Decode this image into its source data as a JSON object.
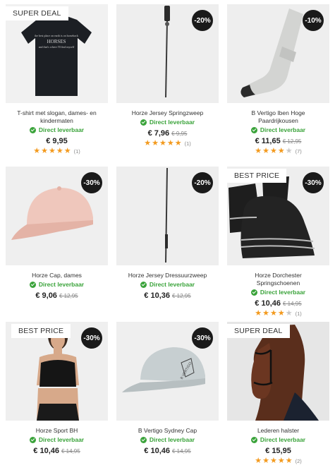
{
  "products": [
    {
      "name": "T-shirt met slogan, dames- en kindermaten",
      "badge": "SUPER DEAL",
      "discount": "",
      "availability": "Direct leverbaar",
      "price": "€ 9,95",
      "old_price": "",
      "rating": 5,
      "review_count": "(1)"
    },
    {
      "name": "Horze Jersey Springzweep",
      "badge": "",
      "discount": "-20%",
      "availability": "Direct leverbaar",
      "price": "€ 7,96",
      "old_price": "€ 9,95",
      "rating": 5,
      "review_count": "(1)"
    },
    {
      "name": "B Vertigo Iben Hoge Paardrijkousen",
      "badge": "",
      "discount": "-10%",
      "availability": "Direct leverbaar",
      "price": "€ 11,65",
      "old_price": "€ 12,95",
      "rating": 4,
      "review_count": "(7)"
    },
    {
      "name": "Horze Cap, dames",
      "badge": "",
      "discount": "-30%",
      "availability": "Direct leverbaar",
      "price": "€ 9,06",
      "old_price": "€ 12,95",
      "rating": 0,
      "review_count": ""
    },
    {
      "name": "Horze Jersey Dressuurzweep",
      "badge": "",
      "discount": "-20%",
      "availability": "Direct leverbaar",
      "price": "€ 10,36",
      "old_price": "€ 12,95",
      "rating": 0,
      "review_count": ""
    },
    {
      "name": "Horze Dorchester Springschoenen",
      "badge": "BEST PRICE",
      "discount": "-30%",
      "availability": "Direct leverbaar",
      "price": "€ 10,46",
      "old_price": "€ 14,95",
      "rating": 4,
      "review_count": "(1)"
    },
    {
      "name": "Horze Sport BH",
      "badge": "BEST PRICE",
      "discount": "-30%",
      "availability": "Direct leverbaar",
      "price": "€ 10,46",
      "old_price": "€ 14,95",
      "rating": 0,
      "review_count": ""
    },
    {
      "name": "B Vertigo Sydney Cap",
      "badge": "",
      "discount": "-30%",
      "availability": "Direct leverbaar",
      "price": "€ 10,46",
      "old_price": "€ 14,95",
      "rating": 0,
      "review_count": ""
    },
    {
      "name": "Lederen halster",
      "badge": "SUPER DEAL",
      "discount": "",
      "availability": "Direct leverbaar",
      "price": "€ 15,95",
      "old_price": "",
      "rating": 5,
      "review_count": "(2)"
    }
  ],
  "shirt_print": {
    "line1": "the best place on earth is on horseback",
    "line2": "HORSES",
    "line3": "and that's where I'll find myself"
  },
  "cap_print": "B VERTIGO",
  "colors": {
    "availability_green": "#3aa33a",
    "star_orange": "#f39a1e",
    "discount_badge": "#1a1a1a"
  }
}
